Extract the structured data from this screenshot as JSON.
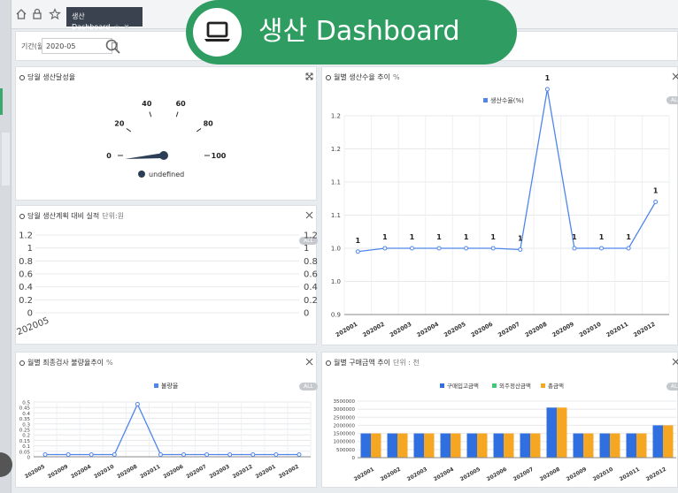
{
  "tab": {
    "label": "생산 Dashboard"
  },
  "banner": {
    "title": "생산 Dashboard"
  },
  "filter": {
    "label": "기간(월)",
    "value": "2020-05"
  },
  "panels": {
    "p1": {
      "title": "당월 생산달성율",
      "unit": ""
    },
    "p2": {
      "title": "월별 생산수율 추이",
      "unit": "%",
      "all": "ALL"
    },
    "p3": {
      "title": "당월 생산계획 대비 실적",
      "unit": "단위:원",
      "all": "ALL"
    },
    "p4": {
      "title": "월별 최종검사 불량율추이",
      "unit": "%",
      "all": "ALL"
    },
    "p5": {
      "title": "월별 구매금액 추이",
      "unit": "단위 : 천",
      "all": "ALL"
    }
  },
  "chart_data": [
    {
      "type": "gauge",
      "ticks": [
        "0",
        "20",
        "40",
        "60",
        "80",
        "100"
      ],
      "value": 0,
      "legend": "undefined"
    },
    {
      "type": "line",
      "series": [
        {
          "name": "생산수율(%)",
          "color": "#4f86ec",
          "values": [
            0.995,
            1.0,
            1.0,
            1.0,
            1.0,
            1.0,
            0.998,
            1.24,
            1.0,
            1.0,
            1.0,
            1.07
          ]
        }
      ],
      "categories": [
        "202001",
        "202002",
        "202003",
        "202004",
        "202005",
        "202006",
        "202007",
        "202008",
        "202009",
        "202010",
        "202011",
        "202012"
      ],
      "data_labels": [
        "1",
        "1",
        "1",
        "1",
        "1",
        "1",
        "1",
        "1",
        "1",
        "1",
        "1",
        "1"
      ],
      "ylim": [
        0.9,
        1.2
      ],
      "yticks": [
        "1.2",
        "1.2",
        "1.1",
        "1.1",
        "1.0",
        "1.0",
        "0.9"
      ]
    },
    {
      "type": "bar",
      "categories": [
        "202005"
      ],
      "series": [],
      "yticks_left": [
        "1.2",
        "1",
        "0.8",
        "0.6",
        "0.4",
        "0.2",
        "0"
      ],
      "yticks_right": [
        "1.2",
        "1",
        "0.8",
        "0.6",
        "0.4",
        "0.2",
        "0"
      ]
    },
    {
      "type": "line",
      "series": [
        {
          "name": "불량율",
          "color": "#4f86ec",
          "values": [
            0.02,
            0.02,
            0.02,
            0.02,
            0.48,
            0.02,
            0.02,
            0.02,
            0.02,
            0.02,
            0.02,
            0.02
          ]
        }
      ],
      "categories": [
        "202005",
        "202009",
        "202004",
        "202010",
        "202008",
        "202011",
        "202006",
        "202007",
        "202003",
        "202012",
        "202001",
        "202002"
      ],
      "ylim": [
        0,
        0.5
      ],
      "yticks": [
        "0.5",
        "0.45",
        "0.4",
        "0.35",
        "0.3",
        "0.25",
        "0.2",
        "0.15",
        "0.1",
        "0.05",
        "0"
      ]
    },
    {
      "type": "bar",
      "categories": [
        "202001",
        "202002",
        "202003",
        "202004",
        "202005",
        "202006",
        "202007",
        "202008",
        "202009",
        "202010",
        "202011",
        "202012"
      ],
      "series": [
        {
          "name": "구매입고금액",
          "color": "#2f6fe0",
          "values": [
            1500000,
            1500000,
            1500000,
            1500000,
            1500000,
            1500000,
            1500000,
            3100000,
            1500000,
            1500000,
            1500000,
            2000000
          ]
        },
        {
          "name": "외주정산금액",
          "color": "#3ec97a",
          "values": [
            0,
            0,
            0,
            0,
            0,
            0,
            0,
            0,
            0,
            0,
            0,
            0
          ]
        },
        {
          "name": "총금액",
          "color": "#f5a623",
          "values": [
            1500000,
            1500000,
            1500000,
            1500000,
            1500000,
            1500000,
            1500000,
            3100000,
            1500000,
            1500000,
            1500000,
            2000000
          ]
        }
      ],
      "ylim": [
        0,
        3500000
      ],
      "yticks": [
        "3500000",
        "3000000",
        "2500000",
        "2000000",
        "1500000",
        "1000000",
        "500000",
        "0"
      ]
    }
  ]
}
